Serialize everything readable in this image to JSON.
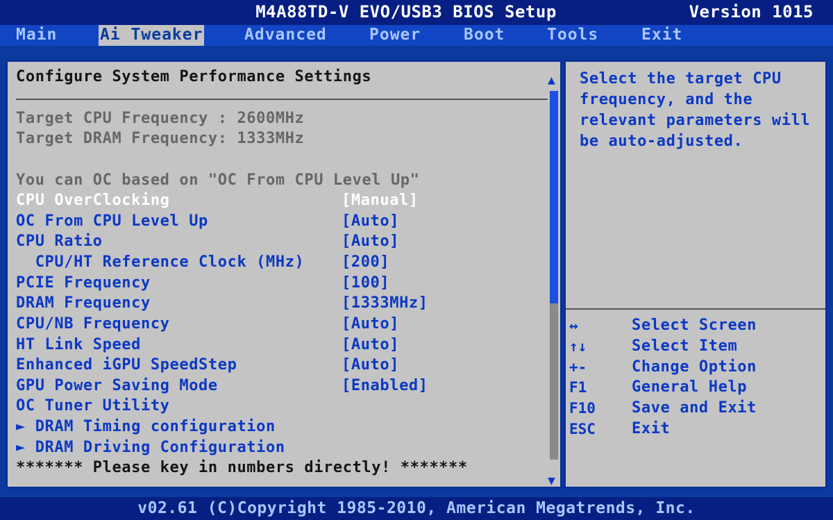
{
  "header": {
    "title": "M4A88TD-V EVO/USB3 BIOS Setup",
    "version": "Version 1015"
  },
  "menu": [
    {
      "label": "Main"
    },
    {
      "label": "Ai Tweaker",
      "active": true
    },
    {
      "label": "Advanced"
    },
    {
      "label": "Power"
    },
    {
      "label": "Boot"
    },
    {
      "label": "Tools"
    },
    {
      "label": "Exit"
    }
  ],
  "panel": {
    "heading": "Configure System Performance Settings",
    "target_cpu": "Target CPU Frequency : 2600MHz",
    "target_dram": "Target DRAM Frequency: 1333MHz",
    "oc_note": "You can OC based on \"OC From CPU Level Up\"",
    "options": [
      {
        "label": "CPU OverClocking",
        "value": "[Manual]",
        "selected": true
      },
      {
        "label": "OC From CPU Level Up",
        "value": "[Auto]"
      },
      {
        "label": "CPU Ratio",
        "value": "[Auto]"
      },
      {
        "label": "  CPU/HT Reference Clock (MHz)",
        "value": "[200]"
      },
      {
        "label": "PCIE Frequency",
        "value": "[100]"
      },
      {
        "label": "DRAM Frequency",
        "value": "[1333MHz]"
      },
      {
        "label": "CPU/NB Frequency",
        "value": "[Auto]"
      },
      {
        "label": "HT Link Speed",
        "value": "[Auto]"
      },
      {
        "label": "Enhanced iGPU SpeedStep",
        "value": "[Auto]"
      },
      {
        "label": "GPU Power Saving Mode",
        "value": "[Enabled]"
      },
      {
        "label": "OC Tuner Utility",
        "value": ""
      },
      {
        "label": "► DRAM Timing configuration",
        "value": ""
      },
      {
        "label": "► DRAM Driving Configuration",
        "value": ""
      }
    ],
    "bottom_note": "******* Please key in numbers directly! *******"
  },
  "help": {
    "text": "Select the target CPU frequency, and the relevant parameters will be auto-adjusted.",
    "keys": [
      {
        "key": "↔",
        "desc": "Select Screen"
      },
      {
        "key": "↑↓",
        "desc": "Select Item"
      },
      {
        "key": "+-",
        "desc": "Change Option"
      },
      {
        "key": "F1",
        "desc": "General Help"
      },
      {
        "key": "F10",
        "desc": "Save and Exit"
      },
      {
        "key": "ESC",
        "desc": "Exit"
      }
    ]
  },
  "footer": "v02.61 (C)Copyright 1985-2010, American Megatrends, Inc.",
  "colors": {
    "background": "#0a3a9e",
    "panel": "#c4c4c4",
    "option_text": "#0b38c4",
    "selected_text": "#ffffff",
    "menu_active_bg": "#c3c3c3"
  }
}
